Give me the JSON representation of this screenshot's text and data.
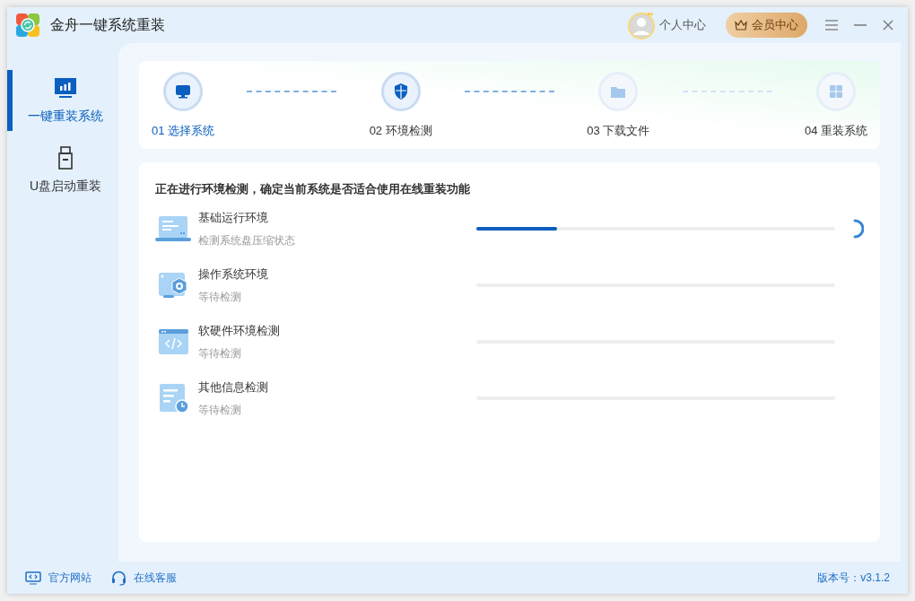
{
  "window": {
    "title": "金舟一键系统重装"
  },
  "header": {
    "profile": "个人中心",
    "vip": "会员中心"
  },
  "sidebar": {
    "items": [
      {
        "label": "一键重装系统",
        "selected": true
      },
      {
        "label": "U盘启动重装",
        "selected": false
      }
    ]
  },
  "steps": [
    {
      "label": "01 选择系统",
      "selected": true,
      "reached": true
    },
    {
      "label": "02 环境检测",
      "selected": false,
      "reached": true
    },
    {
      "label": "03 下载文件",
      "selected": false,
      "reached": false
    },
    {
      "label": "04 重装系统",
      "selected": false,
      "reached": false
    }
  ],
  "check": {
    "heading": "正在进行环境检测，确定当前系统是否适合使用在线重装功能",
    "items": [
      {
        "title": "基础运行环境",
        "status": "检测系统盘压缩状态",
        "level": 0.225,
        "running": true
      },
      {
        "title": "操作系统环境",
        "status": "等待检测",
        "level": 0,
        "running": false
      },
      {
        "title": "软硬件环境检测",
        "status": "等待检测",
        "level": 0,
        "running": false
      },
      {
        "title": "其他信息检测",
        "status": "等待检测",
        "level": 0,
        "running": false
      }
    ]
  },
  "footer": {
    "links": [
      "官方网站",
      "在线客服"
    ],
    "version": "版本号：v3.1.2"
  }
}
